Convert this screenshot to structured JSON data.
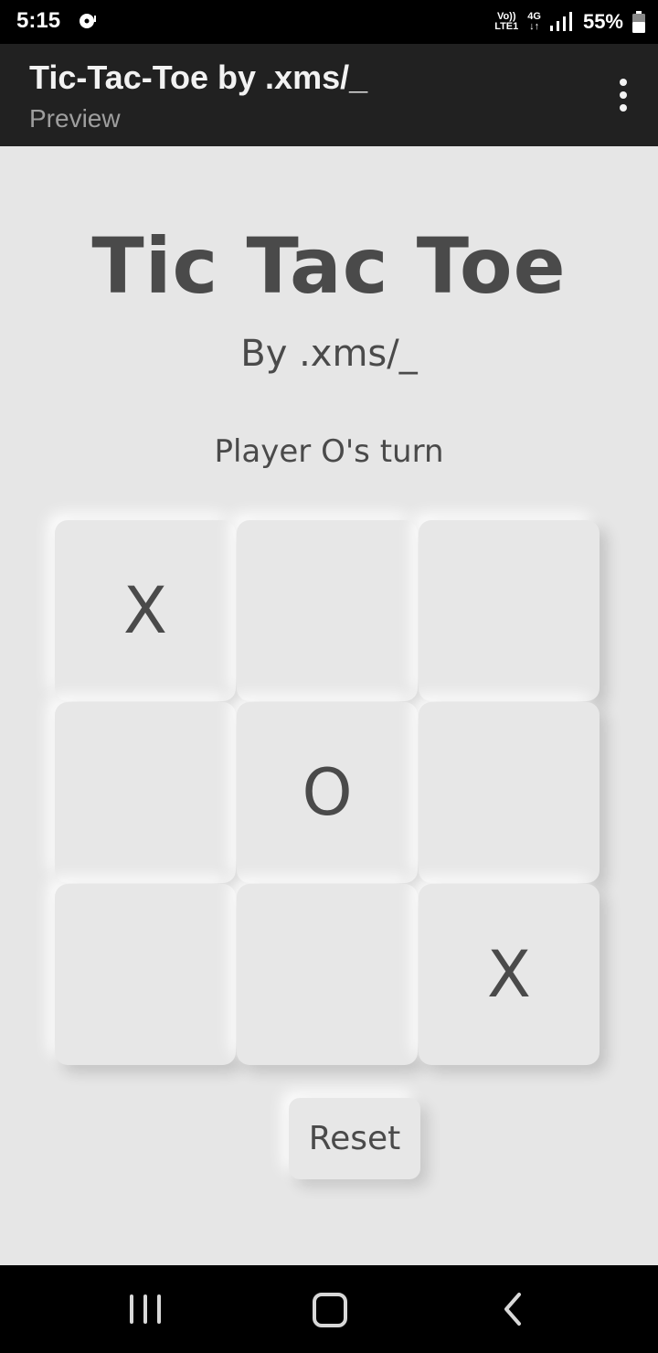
{
  "status_bar": {
    "time": "5:15",
    "volte_line1": "Vo))",
    "volte_line2": "LTE1",
    "network_type": "4G",
    "battery_percent": "55%"
  },
  "app_bar": {
    "title": "Tic-Tac-Toe by .xms/_",
    "subtitle": "Preview"
  },
  "game": {
    "title": "Tic Tac Toe",
    "byline": "By .xms/_",
    "turn_text": "Player O's turn",
    "board": [
      "X",
      "",
      "",
      "",
      "O",
      "",
      "",
      "",
      "X"
    ],
    "reset_label": "Reset"
  },
  "icons": {
    "overflow": "more-vert-icon",
    "notification": "media-icon",
    "signal": "signal-icon",
    "battery": "battery-icon",
    "nav_recents": "recents-icon",
    "nav_home": "home-icon",
    "nav_back": "back-icon"
  },
  "colors": {
    "background": "#e6e6e6",
    "app_bar": "#212121",
    "text": "#4a4a4a"
  }
}
